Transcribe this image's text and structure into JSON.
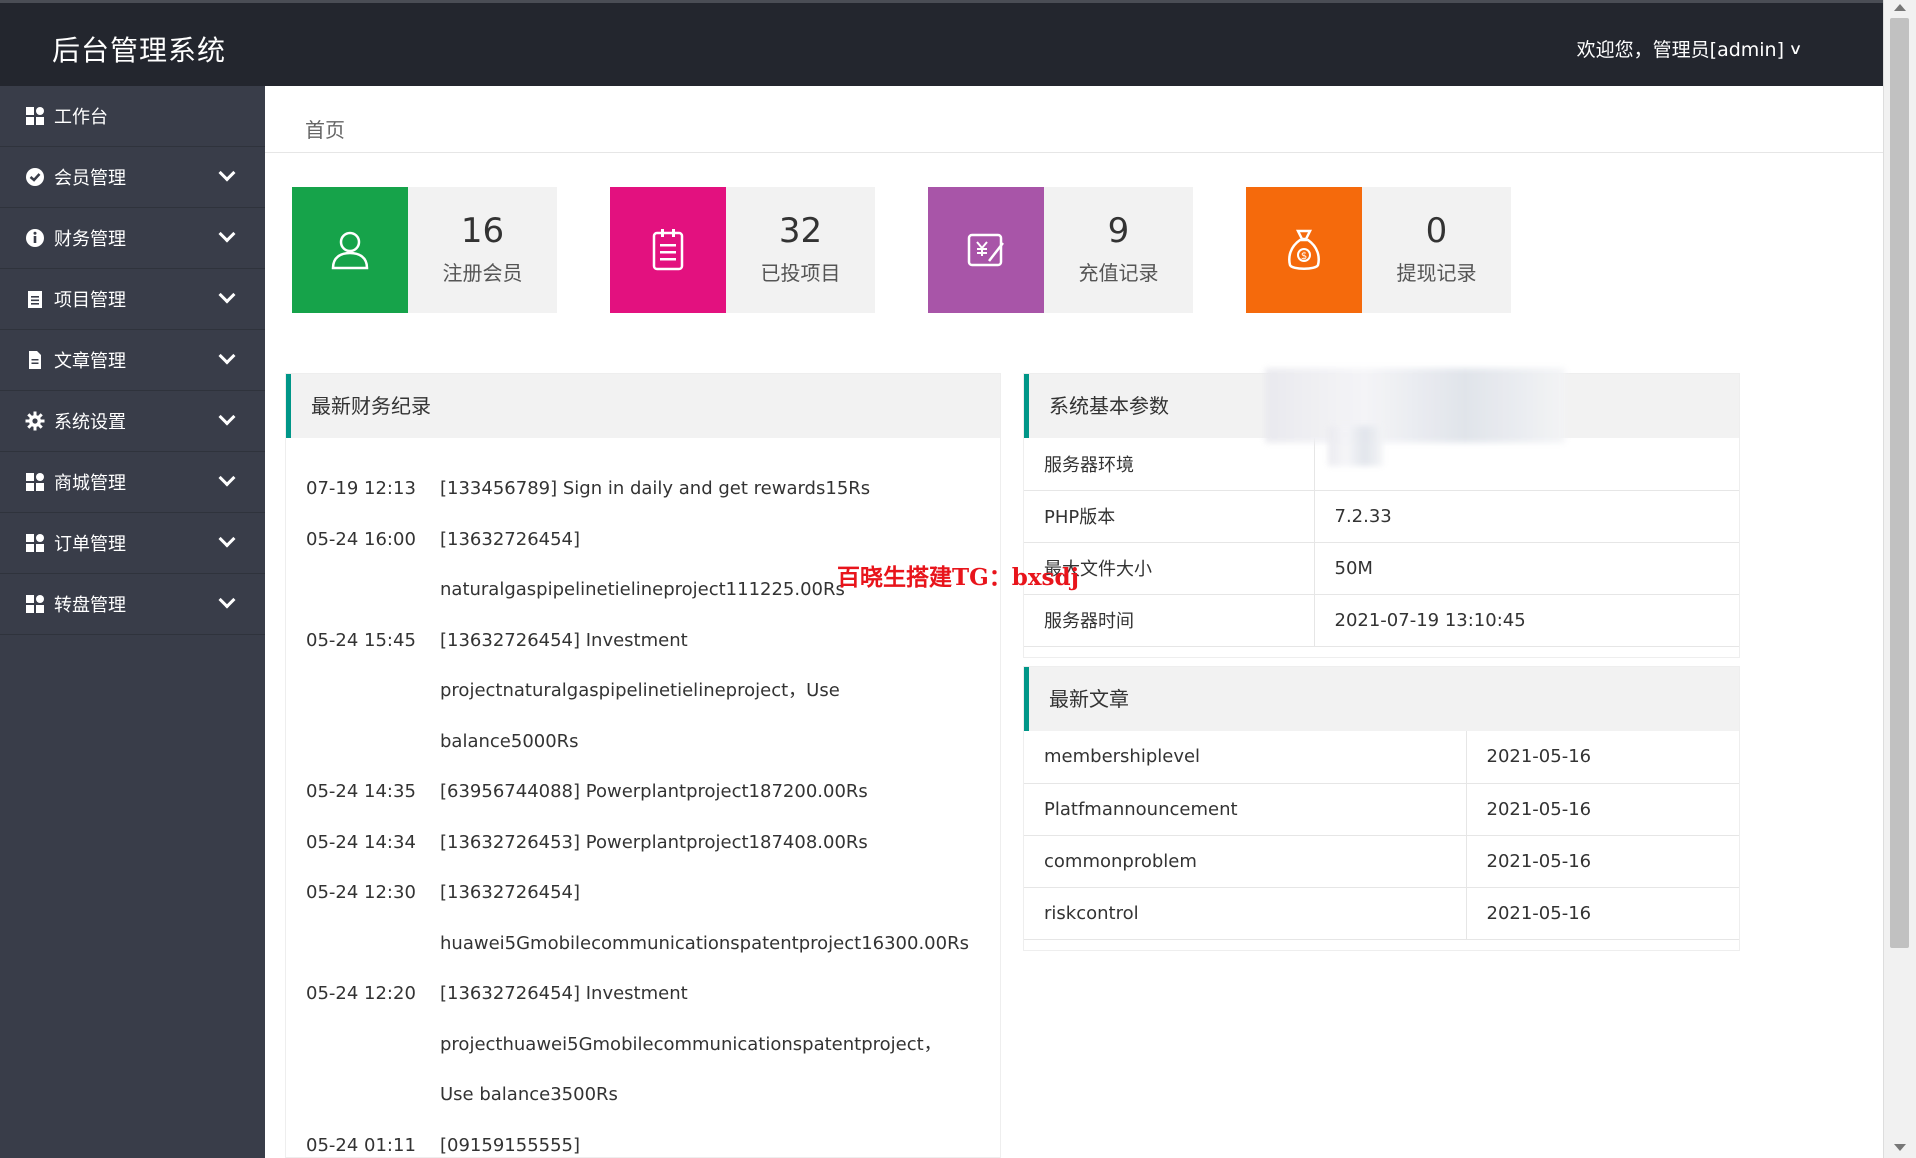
{
  "header": {
    "title": "后台管理系统",
    "user_menu": "欢迎您，管理员[admin]"
  },
  "sidebar": {
    "items": [
      {
        "label": "工作台",
        "icon": "grid-icon"
      },
      {
        "label": "会员管理",
        "icon": "check-circle-icon"
      },
      {
        "label": "财务管理",
        "icon": "info-circle-icon"
      },
      {
        "label": "项目管理",
        "icon": "clipboard-icon"
      },
      {
        "label": "文章管理",
        "icon": "document-icon"
      },
      {
        "label": "系统设置",
        "icon": "gear-icon"
      },
      {
        "label": "商城管理",
        "icon": "grid-icon"
      },
      {
        "label": "订单管理",
        "icon": "grid-icon"
      },
      {
        "label": "转盘管理",
        "icon": "grid-icon"
      }
    ]
  },
  "breadcrumb": "首页",
  "stats": [
    {
      "value": "16",
      "label": "注册会员",
      "color": "#16a34a",
      "icon": "user-icon"
    },
    {
      "value": "32",
      "label": "已投项目",
      "color": "#e3117f",
      "icon": "clipboard-icon"
    },
    {
      "value": "9",
      "label": "充值记录",
      "color": "#a855a8",
      "icon": "yen-edit-icon"
    },
    {
      "value": "0",
      "label": "提现记录",
      "color": "#f56a0c",
      "icon": "money-bag-icon"
    }
  ],
  "finance": {
    "title": "最新财务纪录",
    "rows": [
      {
        "time": "07-19 12:13",
        "desc": "[133456789] Sign in daily and get rewards15Rs"
      },
      {
        "time": "05-24 16:00",
        "desc": "[13632726454]"
      },
      {
        "time": "",
        "desc": "naturalgaspipelinetielineproject111225.00Rs"
      },
      {
        "time": "05-24 15:45",
        "desc": "[13632726454] Investment"
      },
      {
        "time": "",
        "desc": "projectnaturalgaspipelinetielineproject，Use"
      },
      {
        "time": "",
        "desc": "balance5000Rs"
      },
      {
        "time": "05-24 14:35",
        "desc": "[63956744088] Powerplantproject187200.00Rs"
      },
      {
        "time": "05-24 14:34",
        "desc": "[13632726453] Powerplantproject187408.00Rs"
      },
      {
        "time": "05-24 12:30",
        "desc": "[13632726454]"
      },
      {
        "time": "",
        "desc": "huawei5Gmobilecommunicationspatentproject16300.00Rs"
      },
      {
        "time": "05-24 12:20",
        "desc": "[13632726454] Investment"
      },
      {
        "time": "",
        "desc": "projecthuawei5Gmobilecommunicationspatentproject，"
      },
      {
        "time": "",
        "desc": "Use balance3500Rs"
      },
      {
        "time": "05-24 01:11",
        "desc": "[09159155555]"
      }
    ]
  },
  "system": {
    "title": "系统基本参数",
    "rows": [
      {
        "key": "服务器环境",
        "value": ""
      },
      {
        "key": "PHP版本",
        "value": "7.2.33"
      },
      {
        "key": "最大文件大小",
        "value": "50M"
      },
      {
        "key": "服务器时间",
        "value": "2021-07-19 13:10:45"
      }
    ]
  },
  "articles": {
    "title": "最新文章",
    "rows": [
      {
        "name": "membershiplevel",
        "date": "2021-05-16"
      },
      {
        "name": "Platfmannouncement",
        "date": "2021-05-16"
      },
      {
        "name": "commonproblem",
        "date": "2021-05-16"
      },
      {
        "name": "riskcontrol",
        "date": "2021-05-16"
      }
    ]
  },
  "watermark": "百晓生搭建TG：bxsdj"
}
